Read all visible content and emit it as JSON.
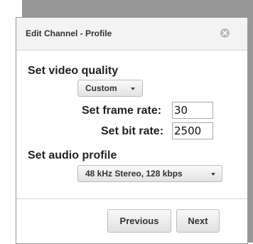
{
  "dialog": {
    "title": "Edit Channel - Profile"
  },
  "video": {
    "section_label": "Set video quality",
    "quality_selected": "Custom",
    "frame_rate_label": "Set frame rate:",
    "frame_rate_value": "30",
    "bit_rate_label": "Set bit rate:",
    "bit_rate_value": "2500"
  },
  "audio": {
    "section_label": "Set audio profile",
    "profile_selected": "48 kHz Stereo, 128 kbps"
  },
  "footer": {
    "previous_label": "Previous",
    "next_label": "Next"
  },
  "icons": {
    "close": "close-icon",
    "dropdown": "chevron-down-icon"
  },
  "colors": {
    "backdrop": "#979797",
    "titlebar": "#f3f3f3",
    "border": "#bdbdbd"
  }
}
